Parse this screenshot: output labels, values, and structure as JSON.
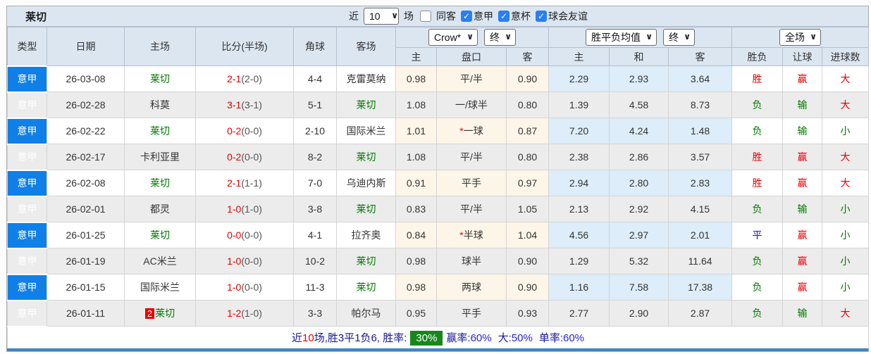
{
  "header": {
    "team": "莱切",
    "near_label": "近",
    "match_count": "10",
    "matches_label": "场",
    "checkboxes": [
      {
        "label": "同客",
        "checked": false
      },
      {
        "label": "意甲",
        "checked": true
      },
      {
        "label": "意杯",
        "checked": true
      },
      {
        "label": "球会友谊",
        "checked": true
      }
    ]
  },
  "columns": {
    "type": "类型",
    "date": "日期",
    "home": "主场",
    "score": "比分(半场)",
    "corner": "角球",
    "away": "客场",
    "crow_select": "Crow*",
    "final_select_1": "终",
    "odds_home": "主",
    "handicap": "盘口",
    "odds_away": "客",
    "avg_select": "胜平负均值",
    "final_select_2": "终",
    "avg_home": "主",
    "avg_draw": "和",
    "avg_away": "客",
    "fulltime_select": "全场",
    "result": "胜负",
    "handicap_result": "让球",
    "goals": "进球数"
  },
  "colors": {
    "league_blue": "#1080e8",
    "win_red": "#e60000",
    "lose_green": "#007a00",
    "draw_blue": "#1414cc",
    "crow_col_bg": "#fcf5e8",
    "avg_col_bg": "#ddedf9",
    "header_bg": "#dce6f1",
    "win_rate_badge_bg": "#17871c"
  },
  "rows": [
    {
      "league": "意甲",
      "date": "26-03-08",
      "home": "莱切",
      "home_is_team": true,
      "home_badge": "",
      "score": "2-1",
      "half": "(2-0)",
      "corner": "4-4",
      "away": "克雷莫纳",
      "away_is_team": false,
      "odds_home": "0.98",
      "handicap": "平/半",
      "handicap_star": false,
      "odds_away": "0.90",
      "avg_home": "2.29",
      "avg_draw": "2.93",
      "avg_away": "3.64",
      "result": "胜",
      "result_color": "red",
      "handicap_result": "赢",
      "handicap_color": "red",
      "goals": "大",
      "goals_color": "red"
    },
    {
      "league": "意甲",
      "date": "26-02-28",
      "home": "科莫",
      "home_is_team": false,
      "home_badge": "",
      "score": "3-1",
      "half": "(3-1)",
      "corner": "5-1",
      "away": "莱切",
      "away_is_team": true,
      "odds_home": "1.08",
      "handicap": "一/球半",
      "handicap_star": false,
      "odds_away": "0.80",
      "avg_home": "1.39",
      "avg_draw": "4.58",
      "avg_away": "8.73",
      "result": "负",
      "result_color": "green",
      "handicap_result": "输",
      "handicap_color": "green",
      "goals": "大",
      "goals_color": "red"
    },
    {
      "league": "意甲",
      "date": "26-02-22",
      "home": "莱切",
      "home_is_team": true,
      "home_badge": "",
      "score": "0-2",
      "half": "(0-0)",
      "corner": "2-10",
      "away": "国际米兰",
      "away_is_team": false,
      "odds_home": "1.01",
      "handicap": "一球",
      "handicap_star": true,
      "odds_away": "0.87",
      "avg_home": "7.20",
      "avg_draw": "4.24",
      "avg_away": "1.48",
      "result": "负",
      "result_color": "green",
      "handicap_result": "输",
      "handicap_color": "green",
      "goals": "小",
      "goals_color": "green"
    },
    {
      "league": "意甲",
      "date": "26-02-17",
      "home": "卡利亚里",
      "home_is_team": false,
      "home_badge": "",
      "score": "0-2",
      "half": "(0-0)",
      "corner": "8-2",
      "away": "莱切",
      "away_is_team": true,
      "odds_home": "1.08",
      "handicap": "平/半",
      "handicap_star": false,
      "odds_away": "0.80",
      "avg_home": "2.38",
      "avg_draw": "2.86",
      "avg_away": "3.57",
      "result": "胜",
      "result_color": "red",
      "handicap_result": "赢",
      "handicap_color": "red",
      "goals": "大",
      "goals_color": "red"
    },
    {
      "league": "意甲",
      "date": "26-02-08",
      "home": "莱切",
      "home_is_team": true,
      "home_badge": "",
      "score": "2-1",
      "half": "(1-1)",
      "corner": "7-0",
      "away": "乌迪内斯",
      "away_is_team": false,
      "odds_home": "0.91",
      "handicap": "平手",
      "handicap_star": false,
      "odds_away": "0.97",
      "avg_home": "2.94",
      "avg_draw": "2.80",
      "avg_away": "2.83",
      "result": "胜",
      "result_color": "red",
      "handicap_result": "赢",
      "handicap_color": "red",
      "goals": "大",
      "goals_color": "red"
    },
    {
      "league": "意甲",
      "date": "26-02-01",
      "home": "都灵",
      "home_is_team": false,
      "home_badge": "",
      "score": "1-0",
      "half": "(1-0)",
      "corner": "3-8",
      "away": "莱切",
      "away_is_team": true,
      "odds_home": "0.83",
      "handicap": "平/半",
      "handicap_star": false,
      "odds_away": "1.05",
      "avg_home": "2.13",
      "avg_draw": "2.92",
      "avg_away": "4.15",
      "result": "负",
      "result_color": "green",
      "handicap_result": "输",
      "handicap_color": "green",
      "goals": "小",
      "goals_color": "green"
    },
    {
      "league": "意甲",
      "date": "26-01-25",
      "home": "莱切",
      "home_is_team": true,
      "home_badge": "",
      "score": "0-0",
      "half": "(0-0)",
      "corner": "4-1",
      "away": "拉齐奥",
      "away_is_team": false,
      "odds_home": "0.84",
      "handicap": "半球",
      "handicap_star": true,
      "odds_away": "1.04",
      "avg_home": "4.56",
      "avg_draw": "2.97",
      "avg_away": "2.01",
      "result": "平",
      "result_color": "blue",
      "handicap_result": "赢",
      "handicap_color": "red",
      "goals": "小",
      "goals_color": "green"
    },
    {
      "league": "意甲",
      "date": "26-01-19",
      "home": "AC米兰",
      "home_is_team": false,
      "home_badge": "",
      "score": "1-0",
      "half": "(0-0)",
      "corner": "10-2",
      "away": "莱切",
      "away_is_team": true,
      "odds_home": "0.98",
      "handicap": "球半",
      "handicap_star": false,
      "odds_away": "0.90",
      "avg_home": "1.29",
      "avg_draw": "5.32",
      "avg_away": "11.64",
      "result": "负",
      "result_color": "green",
      "handicap_result": "赢",
      "handicap_color": "red",
      "goals": "小",
      "goals_color": "green"
    },
    {
      "league": "意甲",
      "date": "26-01-15",
      "home": "国际米兰",
      "home_is_team": false,
      "home_badge": "",
      "score": "1-0",
      "half": "(0-0)",
      "corner": "11-3",
      "away": "莱切",
      "away_is_team": true,
      "odds_home": "0.98",
      "handicap": "两球",
      "handicap_star": false,
      "odds_away": "0.90",
      "avg_home": "1.16",
      "avg_draw": "7.58",
      "avg_away": "17.38",
      "result": "负",
      "result_color": "green",
      "handicap_result": "赢",
      "handicap_color": "red",
      "goals": "小",
      "goals_color": "green"
    },
    {
      "league": "意甲",
      "date": "26-01-11",
      "home": "莱切",
      "home_is_team": true,
      "home_badge": "2",
      "score": "1-2",
      "half": "(1-0)",
      "corner": "3-3",
      "away": "帕尔马",
      "away_is_team": false,
      "odds_home": "0.95",
      "handicap": "平手",
      "handicap_star": false,
      "odds_away": "0.93",
      "avg_home": "2.77",
      "avg_draw": "2.90",
      "avg_away": "2.87",
      "result": "负",
      "result_color": "green",
      "handicap_result": "输",
      "handicap_color": "green",
      "goals": "大",
      "goals_color": "red"
    }
  ],
  "footer": {
    "prefix": "近",
    "count": "10",
    "mid": "场,胜3平1负6, 胜率:",
    "win_rate": "30%",
    "stats": [
      {
        "label": "赢率:",
        "value": "60%"
      },
      {
        "label": "大:",
        "value": "50%"
      },
      {
        "label": "单率:",
        "value": "60%"
      }
    ]
  }
}
